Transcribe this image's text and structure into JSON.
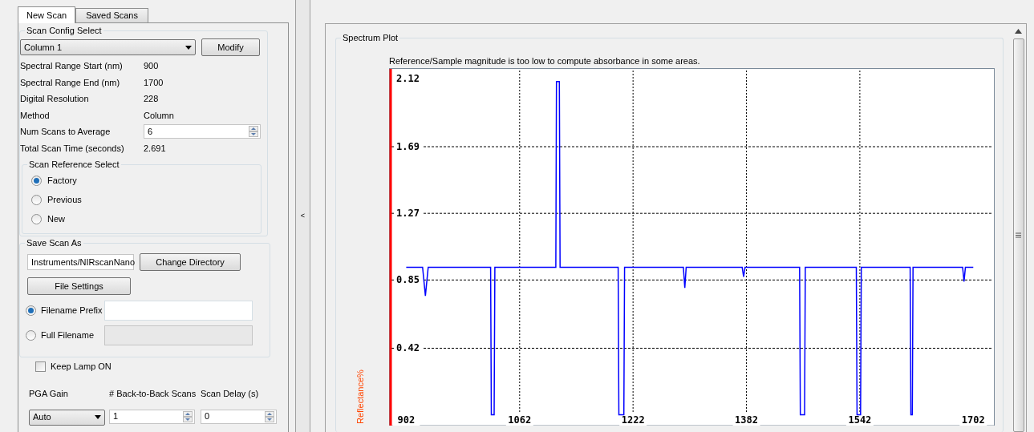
{
  "tabs": [
    {
      "label": "New Scan",
      "selected": true
    },
    {
      "label": "Saved Scans",
      "selected": false
    }
  ],
  "scan_config": {
    "title": "Scan Config Select",
    "config_select": "Column 1",
    "modify_button": "Modify",
    "fields": [
      {
        "kind": "text",
        "label": "Spectral Range Start (nm)",
        "value": "900"
      },
      {
        "kind": "text",
        "label": "Spectral Range End (nm)",
        "value": "1700"
      },
      {
        "kind": "text",
        "label": "Digital Resolution",
        "value": "228"
      },
      {
        "kind": "text",
        "label": "Method",
        "value": "Column"
      },
      {
        "kind": "spinner",
        "label": "Num Scans to Average",
        "value": "6"
      },
      {
        "kind": "text",
        "label": "Total Scan Time (seconds)",
        "value": "2.691"
      }
    ],
    "reference": {
      "title": "Scan Reference Select",
      "options": [
        {
          "label": "Factory",
          "selected": true
        },
        {
          "label": "Previous",
          "selected": false
        },
        {
          "label": "New",
          "selected": false
        }
      ]
    }
  },
  "save_scan": {
    "title": "Save Scan As",
    "directory": "Instruments/NIRscanNano",
    "change_directory_button": "Change Directory",
    "file_settings_button": "File Settings",
    "options": [
      {
        "label": "Filename Prefix",
        "selected": true
      },
      {
        "label": "Full Filename",
        "selected": false
      }
    ]
  },
  "keep_lamp_on": {
    "label": "Keep Lamp ON",
    "checked": false
  },
  "acquisition": {
    "pga_gain": {
      "label": "PGA Gain",
      "value": "Auto"
    },
    "back_to_back": {
      "label": "# Back-to-Back Scans",
      "value": "1"
    },
    "scan_delay": {
      "label": "Scan Delay (s)",
      "value": "0"
    }
  },
  "splitter": {
    "label": "<"
  },
  "spectrum_plot": {
    "title": "Spectrum Plot",
    "message": "Reference/Sample magnitude is too low to compute absorbance in some areas.",
    "chart_data": {
      "type": "line",
      "ylabel": "Reflectance%",
      "xlim": [
        880,
        1730
      ],
      "grid": true,
      "ylim": [
        -0.07,
        2.18
      ],
      "xticks": [
        902,
        1062,
        1222,
        1382,
        1542,
        1702
      ],
      "yticks": [
        0.42,
        0.85,
        1.27,
        1.69,
        2.12
      ],
      "x": [
        902,
        925,
        929,
        933,
        1021,
        1022,
        1026,
        1027,
        1113,
        1114,
        1116,
        1118,
        1119,
        1201,
        1202,
        1209,
        1210,
        1293,
        1295,
        1297,
        1376,
        1378,
        1380,
        1457,
        1458,
        1464,
        1465,
        1537,
        1538,
        1543,
        1544,
        1613,
        1614,
        1616,
        1617,
        1687,
        1689,
        1691,
        1702
      ],
      "series": [
        {
          "color": "#0000ff",
          "values": [
            0.93,
            0.93,
            0.75,
            0.93,
            0.93,
            0,
            0,
            0.93,
            0.93,
            2.1,
            2.1,
            2.1,
            0.93,
            0.93,
            0,
            0,
            0.93,
            0.93,
            0.8,
            0.93,
            0.93,
            0.87,
            0.93,
            0.93,
            0,
            0,
            0.93,
            0.93,
            0,
            0,
            0.93,
            0.93,
            0,
            0,
            0.93,
            0.93,
            0.84,
            0.93,
            0.93
          ]
        }
      ]
    }
  }
}
